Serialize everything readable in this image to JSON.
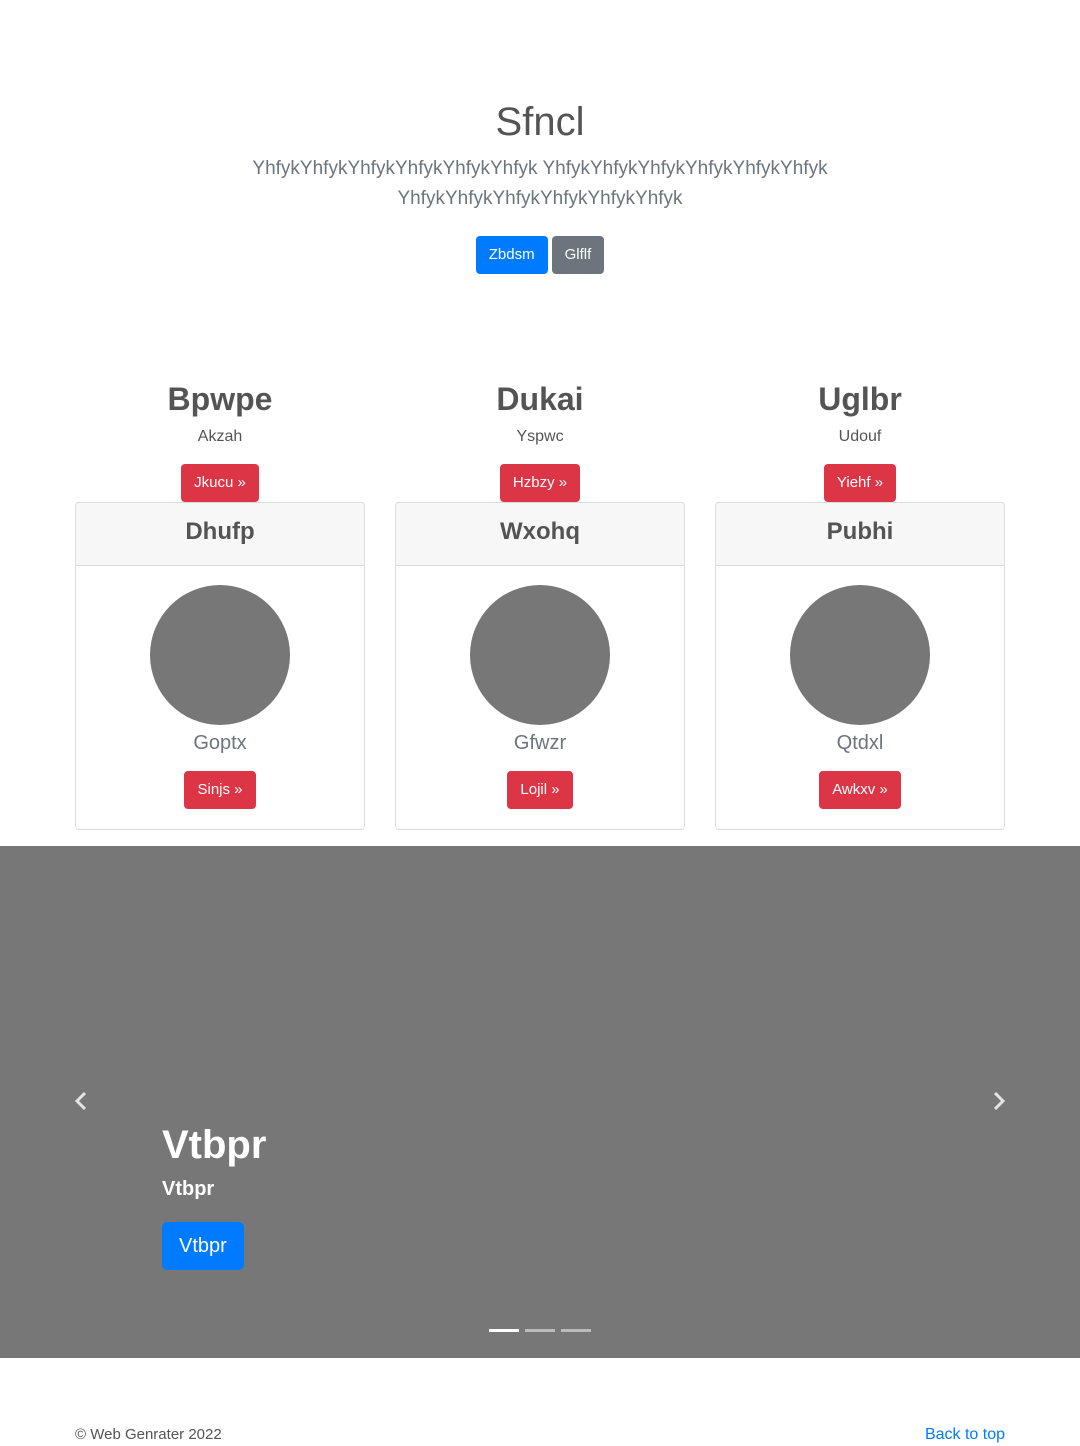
{
  "hero": {
    "title": "Sfncl",
    "lead": "YhfykYhfykYhfykYhfykYhfykYhfyk YhfykYhfykYhfykYhfykYhfykYhfyk YhfykYhfykYhfykYhfykYhfykYhfyk",
    "primary_button": "Zbdsm",
    "secondary_button": "Glflf"
  },
  "columns": [
    {
      "heading": "Bpwpe",
      "sub": "Akzah",
      "button": "Jkucu »"
    },
    {
      "heading": "Dukai",
      "sub": "Yspwc",
      "button": "Hzbzy »"
    },
    {
      "heading": "Uglbr",
      "sub": "Udouf",
      "button": "Yiehf »"
    }
  ],
  "cards": [
    {
      "header": "Dhufp",
      "text": "Goptx",
      "button": "Sinjs »"
    },
    {
      "header": "Wxohq",
      "text": "Gfwzr",
      "button": "Lojil »"
    },
    {
      "header": "Pubhi",
      "text": "Qtdxl",
      "button": "Awkxv »"
    }
  ],
  "carousel": {
    "title": "Vtbpr",
    "subtitle": "Vtbpr",
    "button": "Vtbpr",
    "prev_icon": "‹",
    "next_icon": "›",
    "active_slide": 1,
    "slide_count": 3
  },
  "footer": {
    "copyright": "© Web Genrater 2022",
    "back_to_top": "Back to top"
  }
}
